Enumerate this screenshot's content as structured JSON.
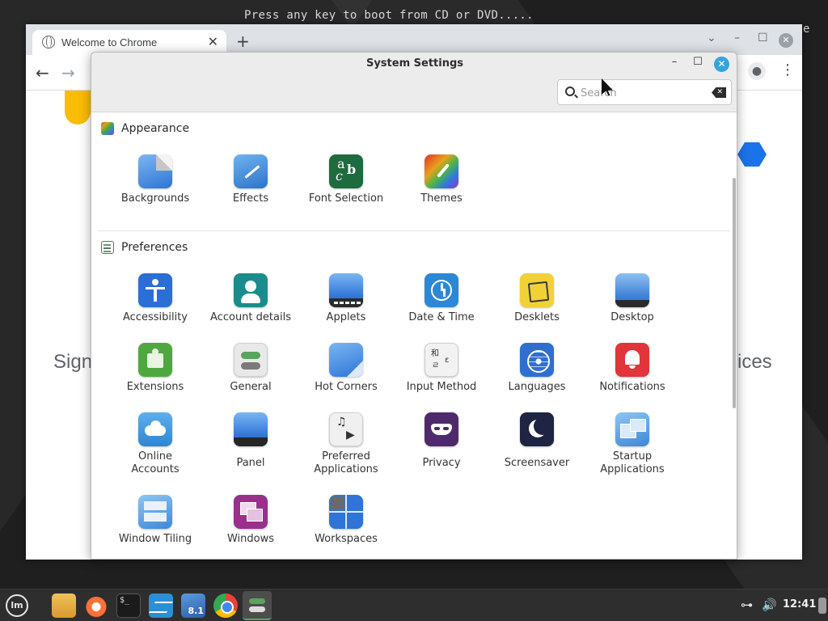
{
  "desktop": {
    "boot_text": "Press any key to boot from CD or DVD.....",
    "edge_char": "e"
  },
  "chrome": {
    "tab_title": "Welcome to Chrome",
    "tab_close": "✕",
    "new_tab": "+",
    "nav_back": "←",
    "nav_forward": "→",
    "bg_sign": "Sign",
    "bg_ices": "ices"
  },
  "settings": {
    "title": "System Settings",
    "minimize": "–",
    "maximize": "☐",
    "close": "✕",
    "search": {
      "placeholder": "Search",
      "value": ""
    },
    "sections": [
      {
        "title": "Appearance",
        "items": [
          "Backgrounds",
          "Effects",
          "Font Selection",
          "Themes"
        ]
      },
      {
        "title": "Preferences",
        "items": [
          "Accessibility",
          "Account details",
          "Applets",
          "Date & Time",
          "Desklets",
          "Desktop",
          "Extensions",
          "General",
          "Hot Corners",
          "Input Method",
          "Languages",
          "Notifications",
          "Online\nAccounts",
          "Panel",
          "Preferred\nApplications",
          "Privacy",
          "Screensaver",
          "Startup\nApplications",
          "Window Tiling",
          "Windows",
          "Workspaces"
        ]
      }
    ]
  },
  "icons": {
    "font_selection_glyphs": [
      "a",
      "b",
      "c"
    ],
    "input_method_glyphs": [
      "和",
      "ㄹ",
      "ɛ"
    ],
    "preferred_glyphs": [
      "♫",
      "▶"
    ]
  },
  "taskbar": {
    "terminal_glyph": "$_",
    "mintinstall_badge": "8.1",
    "clock": "12:41",
    "menu_glyph": "lm"
  }
}
